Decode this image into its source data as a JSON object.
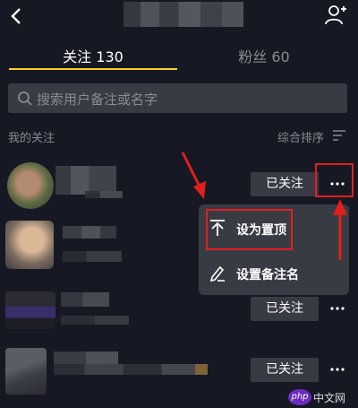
{
  "tabs": {
    "following_label": "关注 130",
    "fans_label": "粉丝 60"
  },
  "search": {
    "placeholder": "搜索用户备注或名字"
  },
  "section": {
    "label": "我的关注",
    "sort_label": "综合排序"
  },
  "rows": [
    {
      "follow_label": "已关注"
    },
    {
      "follow_label": "已关注"
    },
    {
      "follow_label": "已关注"
    },
    {
      "follow_label": "已关注"
    }
  ],
  "menu": {
    "pin_label": "设为置顶",
    "remark_label": "设置备注名"
  },
  "watermark": {
    "logo": "php",
    "text": "中文网"
  },
  "colors": {
    "background": "#161823",
    "accent": "#fece2b",
    "button_bg": "#393b44",
    "annotation": "#e0201c"
  },
  "icons": [
    "back-icon",
    "add-user-icon",
    "search-icon",
    "sort-icon",
    "more-icon",
    "pin-top-icon",
    "edit-icon"
  ]
}
